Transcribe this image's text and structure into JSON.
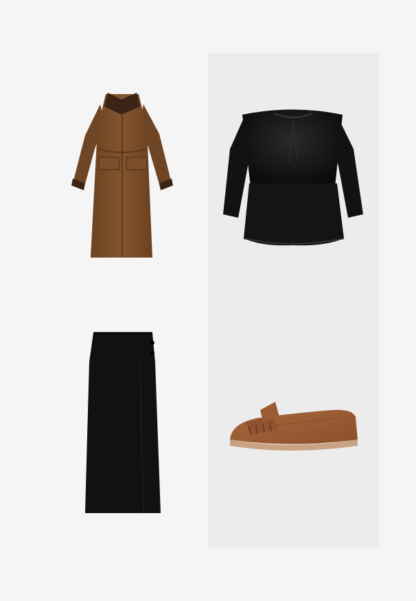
{
  "products": [
    {
      "id": "coat",
      "icon": "trench-coat-image",
      "color": "#7a4e2a"
    },
    {
      "id": "top",
      "icon": "velvet-peplum-top-image",
      "color": "#121212"
    },
    {
      "id": "skirt",
      "icon": "maxi-skirt-image",
      "color": "#111111"
    },
    {
      "id": "shoe",
      "icon": "suede-moccasin-image",
      "color": "#9a5a32"
    }
  ]
}
